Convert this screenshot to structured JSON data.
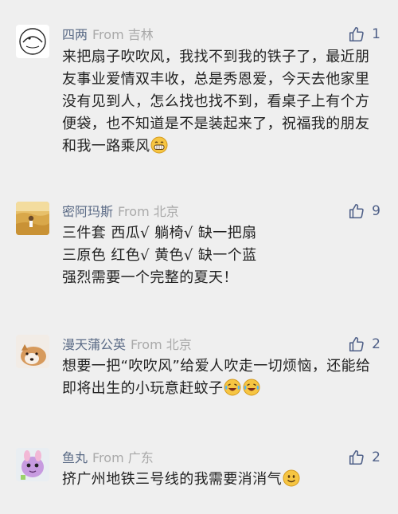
{
  "comments": [
    {
      "user": "四两",
      "location": "From 吉林",
      "likes": "1",
      "text": "来把扇子吹吹风，我找不到我的铁子了，最近朋友事业爱情双丰收，总是秀恩爱，今天去他家里没有见到人，怎么找也找不到，看桌子上有个方便袋，也不知道是不是装起来了，祝福我的朋友和我一路乘风",
      "emojis": [
        "grin-emoji"
      ]
    },
    {
      "user": "密阿玛斯",
      "location": "From 北京",
      "likes": "9",
      "text": "三件套 西瓜√ 躺椅√ 缺一把扇\n三原色 红色√ 黄色√ 缺一个蓝\n强烈需要一个完整的夏天！",
      "emojis": []
    },
    {
      "user": "漫天蒲公英",
      "location": "From 北京",
      "likes": "2",
      "text": "想要一把“吹吹风”给爱人吹走一切烦恼，还能给即将出生的小玩意赶蚊子",
      "emojis": [
        "laugh-tears-emoji",
        "laugh-tears-emoji"
      ]
    },
    {
      "user": "鱼丸",
      "location": "From 广东",
      "likes": "2",
      "text": "挤广州地铁三号线的我需要消消气",
      "emojis": [
        "smile-emoji"
      ]
    }
  ]
}
